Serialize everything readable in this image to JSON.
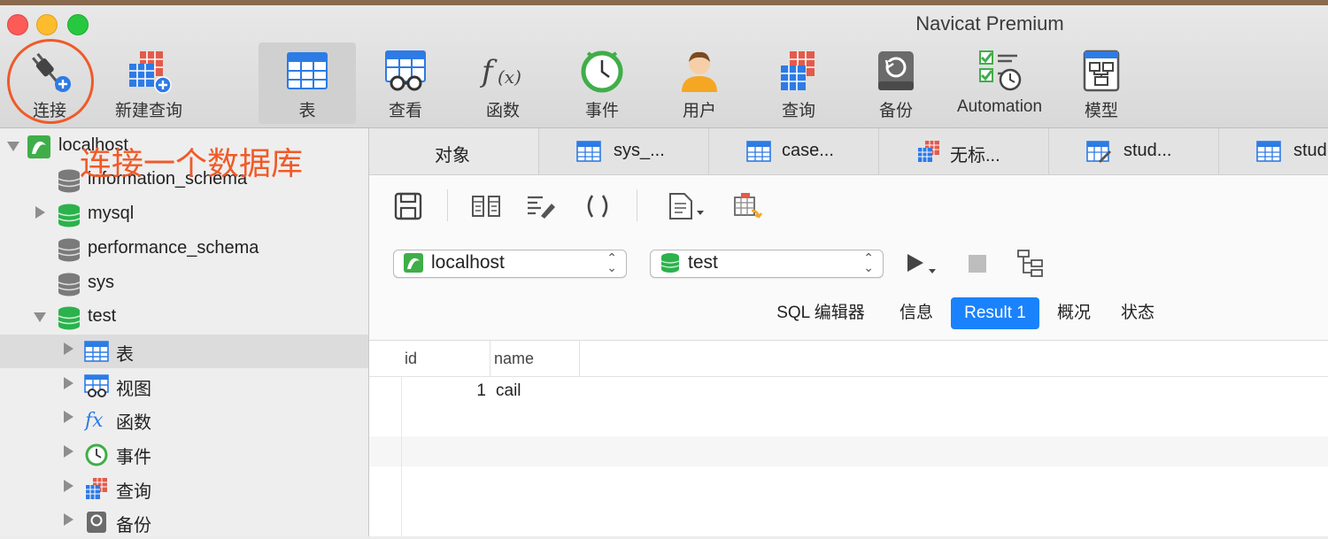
{
  "window": {
    "title": "Navicat Premium"
  },
  "toolbar": {
    "items": [
      {
        "label": "连接",
        "icon": "plug-connect-icon"
      },
      {
        "label": "新建查询",
        "icon": "new-query-icon"
      },
      {
        "label": "表",
        "icon": "table-icon"
      },
      {
        "label": "查看",
        "icon": "view-icon"
      },
      {
        "label": "函数",
        "icon": "function-icon"
      },
      {
        "label": "事件",
        "icon": "clock-event-icon"
      },
      {
        "label": "用户",
        "icon": "user-icon"
      },
      {
        "label": "查询",
        "icon": "query-icon"
      },
      {
        "label": "备份",
        "icon": "backup-icon"
      },
      {
        "label": "Automation",
        "icon": "automation-icon"
      },
      {
        "label": "模型",
        "icon": "model-icon"
      }
    ],
    "active": "表"
  },
  "annotation": {
    "text": "连接一个数据库",
    "color": "#f05a28"
  },
  "sidebar": {
    "connection": "localhost",
    "databases": [
      "information_schema",
      "mysql",
      "performance_schema",
      "sys",
      "test"
    ],
    "test_children": [
      "表",
      "视图",
      "函数",
      "事件",
      "查询",
      "备份"
    ]
  },
  "tabs": [
    "对象",
    "sys_...",
    "case...",
    "无标...",
    "stud...",
    "stud"
  ],
  "query": {
    "connection": "localhost",
    "database": "test"
  },
  "result_tabs": [
    "SQL 编辑器",
    "信息",
    "Result 1",
    "概况",
    "状态"
  ],
  "active_result_tab": "Result 1",
  "result": {
    "columns": [
      "id",
      "name"
    ],
    "rows": [
      {
        "id": "1",
        "name": "cail"
      }
    ]
  },
  "colors": {
    "accent": "#1a82fb",
    "db_green": "#2bb24c",
    "annotation": "#f05a28"
  }
}
